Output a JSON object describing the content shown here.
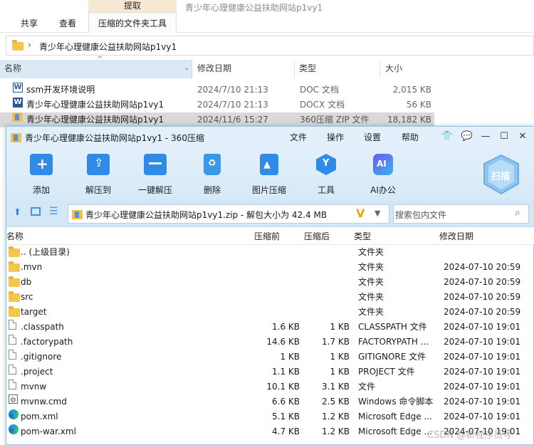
{
  "explorer": {
    "context_header": "提取",
    "tabs": [
      "共享",
      "查看"
    ],
    "context_tab": "压缩的文件夹工具",
    "faint_title": "青少年心理健康公益扶助网站p1vy1",
    "address": "青少年心理健康公益扶助网站p1vy1",
    "columns": {
      "name": "名称",
      "date": "修改日期",
      "type": "类型",
      "size": "大小"
    },
    "files": [
      {
        "name": "ssm开发环境说明",
        "date": "2024/7/10 21:13",
        "type": "DOC 文档",
        "size": "2,015 KB",
        "icon": "word-doc-icon"
      },
      {
        "name": "青少年心理健康公益扶助网站p1vy1",
        "date": "2024/7/10 21:13",
        "type": "DOCX 文档",
        "size": "56 KB",
        "icon": "word-docx-icon"
      },
      {
        "name": "青少年心理健康公益扶助网站p1vy1",
        "date": "2024/11/6 15:27",
        "type": "360压缩 ZIP 文件",
        "size": "18,182 KB",
        "icon": "zip-icon",
        "selected": true
      }
    ]
  },
  "win360": {
    "title": "青少年心理健康公益扶助网站p1vy1 - 360压缩",
    "menu": [
      "文件",
      "操作",
      "设置",
      "帮助"
    ],
    "tools": [
      "添加",
      "解压到",
      "一键解压",
      "删除",
      "图片压缩",
      "工具",
      "AI办公"
    ],
    "scan_label": "扫描",
    "path": "青少年心理健康公益扶助网站p1vy1.zip - 解包大小为 42.4 MB",
    "search_placeholder": "搜索包内文件",
    "columns": {
      "name": "名称",
      "compressed": "压缩前",
      "after": "压缩后",
      "type": "类型",
      "date": "修改日期"
    },
    "rows": [
      {
        "name": ".. (上级目录)",
        "before": "",
        "after": "",
        "type": "文件夹",
        "date": "",
        "icon": "folder"
      },
      {
        "name": ".mvn",
        "before": "",
        "after": "",
        "type": "文件夹",
        "date": "2024-07-10 20:59",
        "icon": "folder"
      },
      {
        "name": "db",
        "before": "",
        "after": "",
        "type": "文件夹",
        "date": "2024-07-10 20:59",
        "icon": "folder"
      },
      {
        "name": "src",
        "before": "",
        "after": "",
        "type": "文件夹",
        "date": "2024-07-10 20:59",
        "icon": "folder"
      },
      {
        "name": "target",
        "before": "",
        "after": "",
        "type": "文件夹",
        "date": "2024-07-10 20:59",
        "icon": "folder"
      },
      {
        "name": ".classpath",
        "before": "1.6 KB",
        "after": "1 KB",
        "type": "CLASSPATH 文件",
        "date": "2024-07-10 19:01",
        "icon": "file"
      },
      {
        "name": ".factorypath",
        "before": "14.6 KB",
        "after": "1.7 KB",
        "type": "FACTORYPATH ...",
        "date": "2024-07-10 19:01",
        "icon": "file"
      },
      {
        "name": ".gitignore",
        "before": "1 KB",
        "after": "1 KB",
        "type": "GITIGNORE 文件",
        "date": "2024-07-10 19:01",
        "icon": "file"
      },
      {
        "name": ".project",
        "before": "1.1 KB",
        "after": "1 KB",
        "type": "PROJECT 文件",
        "date": "2024-07-10 19:01",
        "icon": "file"
      },
      {
        "name": "mvnw",
        "before": "10.1 KB",
        "after": "3.1 KB",
        "type": "文件",
        "date": "2024-07-10 19:01",
        "icon": "file"
      },
      {
        "name": "mvnw.cmd",
        "before": "6.6 KB",
        "after": "2.5 KB",
        "type": "Windows 命令脚本",
        "date": "2024-07-10 19:01",
        "icon": "cmd"
      },
      {
        "name": "pom.xml",
        "before": "5.1 KB",
        "after": "1.2 KB",
        "type": "Microsoft Edge ...",
        "date": "2024-07-10 19:01",
        "icon": "edge"
      },
      {
        "name": "pom-war.xml",
        "before": "4.7 KB",
        "after": "1.2 KB",
        "type": "Microsoft Edge ...",
        "date": "2024-07-10 19:01",
        "icon": "edge"
      }
    ]
  },
  "watermark": "CSDN @新程序员号"
}
